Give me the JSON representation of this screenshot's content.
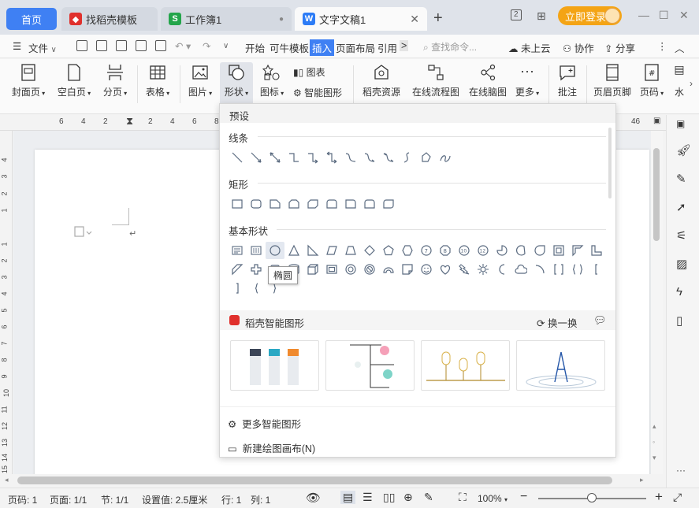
{
  "tabs": {
    "home": "首页",
    "find_template": "找稻壳模板",
    "workbook": "工作簿1",
    "document": "文字文稿1",
    "new_tab": "+"
  },
  "titlebar": {
    "login": "立即登录",
    "page_badge": "2"
  },
  "menu": {
    "file": "文件",
    "items": [
      "开始",
      "可牛模板",
      "插入",
      "页面布局",
      "引用"
    ],
    "more": ">",
    "search_placeholder": "查找命令...",
    "cloud": "未上云",
    "collab": "协作",
    "share": "分享"
  },
  "ribbon": {
    "cover": "封面页",
    "blank": "空白页",
    "pagebreak": "分页",
    "table": "表格",
    "picture": "图片",
    "shape": "形状",
    "icon": "图标",
    "chart": "图表",
    "smart_shape": "智能图形",
    "docer_resource": "稻壳资源",
    "online_flow": "在线流程图",
    "online_mind": "在线脑图",
    "more": "更多",
    "comment": "批注",
    "header_footer": "页眉页脚",
    "page_number": "页码",
    "watermark": "水"
  },
  "ruler": {
    "h_ticks": [
      "6",
      "4",
      "2",
      "2",
      "4",
      "6",
      "8",
      "46"
    ],
    "v_ticks": [
      "4",
      "3",
      "2",
      "1",
      "1",
      "2",
      "3",
      "4",
      "5",
      "6",
      "7",
      "8",
      "9",
      "10",
      "11",
      "12",
      "13",
      "14",
      "15"
    ]
  },
  "panel": {
    "preset": "预设",
    "lines": "线条",
    "rect": "矩形",
    "basic": "基本形状",
    "tooltip": "椭圆",
    "smart_title": "稻壳智能图形",
    "swap": "换一换",
    "more_smart": "更多智能图形",
    "new_canvas": "新建绘图画布(N)"
  },
  "status": {
    "page": "页码: 1",
    "pages": "页面: 1/1",
    "section": "节: 1/1",
    "setting": "设置值: 2.5厘米",
    "row": "行: 1",
    "col": "列: 1",
    "zoom": "100%"
  },
  "colors": {
    "accent": "#3f80f3",
    "login": "#f4a415",
    "docer_red": "#e0302c",
    "wps_blue": "#2d7cf6",
    "et_green": "#24a54b"
  }
}
